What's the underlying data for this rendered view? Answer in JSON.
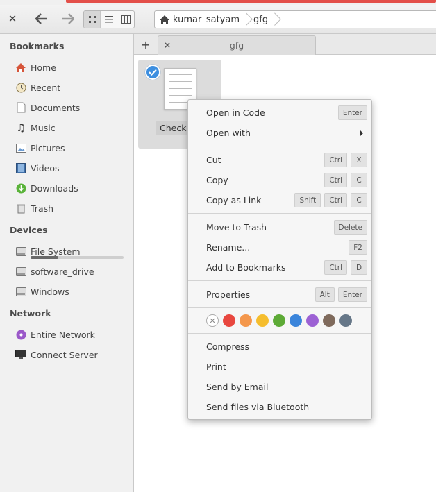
{
  "header": {
    "close_icon": "close-icon",
    "back_icon": "arrow-left-icon",
    "forward_icon": "arrow-right-icon",
    "view_modes": [
      "grid-view-icon",
      "list-view-icon",
      "column-view-icon"
    ],
    "breadcrumbs": [
      "kumar_satyam",
      "gfg"
    ]
  },
  "sidebar": {
    "bookmarks_heading": "Bookmarks",
    "bookmarks": [
      {
        "label": "Home",
        "icon": "home-icon"
      },
      {
        "label": "Recent",
        "icon": "recent-icon"
      },
      {
        "label": "Documents",
        "icon": "documents-icon"
      },
      {
        "label": "Music",
        "icon": "music-icon"
      },
      {
        "label": "Pictures",
        "icon": "pictures-icon"
      },
      {
        "label": "Videos",
        "icon": "videos-icon"
      },
      {
        "label": "Downloads",
        "icon": "downloads-icon"
      },
      {
        "label": "Trash",
        "icon": "trash-icon"
      }
    ],
    "devices_heading": "Devices",
    "devices": [
      {
        "label": "File System",
        "icon": "drive-icon",
        "usage_fraction": 0.3
      },
      {
        "label": "software_drive",
        "icon": "drive-icon"
      },
      {
        "label": "Windows",
        "icon": "drive-icon"
      }
    ],
    "network_heading": "Network",
    "network": [
      {
        "label": "Entire Network",
        "icon": "network-icon"
      },
      {
        "label": "Connect Server",
        "icon": "server-icon"
      }
    ]
  },
  "tabs": {
    "add_label": "+",
    "close_label": "×",
    "active_label": "gfg"
  },
  "file": {
    "name": "Check_"
  },
  "context_menu": {
    "items": [
      {
        "label": "Open in Code",
        "keys": [
          "Enter"
        ]
      },
      {
        "label": "Open with",
        "submenu": true
      },
      {
        "label": "Cut",
        "keys": [
          "Ctrl",
          "X"
        ]
      },
      {
        "label": "Copy",
        "keys": [
          "Ctrl",
          "C"
        ]
      },
      {
        "label": "Copy as Link",
        "keys": [
          "Shift",
          "Ctrl",
          "C"
        ]
      },
      {
        "label": "Move to Trash",
        "keys": [
          "Delete"
        ]
      },
      {
        "label": "Rename...",
        "keys": [
          "F2"
        ]
      },
      {
        "label": "Add to Bookmarks",
        "keys": [
          "Ctrl",
          "D"
        ]
      },
      {
        "label": "Properties",
        "keys": [
          "Alt",
          "Enter"
        ]
      },
      {
        "label": "Compress"
      },
      {
        "label": "Print"
      },
      {
        "label": "Send by Email"
      },
      {
        "label": "Send files via Bluetooth"
      }
    ],
    "colors": [
      "#e8473f",
      "#f4974c",
      "#f5bd2d",
      "#5daa36",
      "#3b85db",
      "#9c61d4",
      "#7f6a5c",
      "#667788"
    ]
  }
}
